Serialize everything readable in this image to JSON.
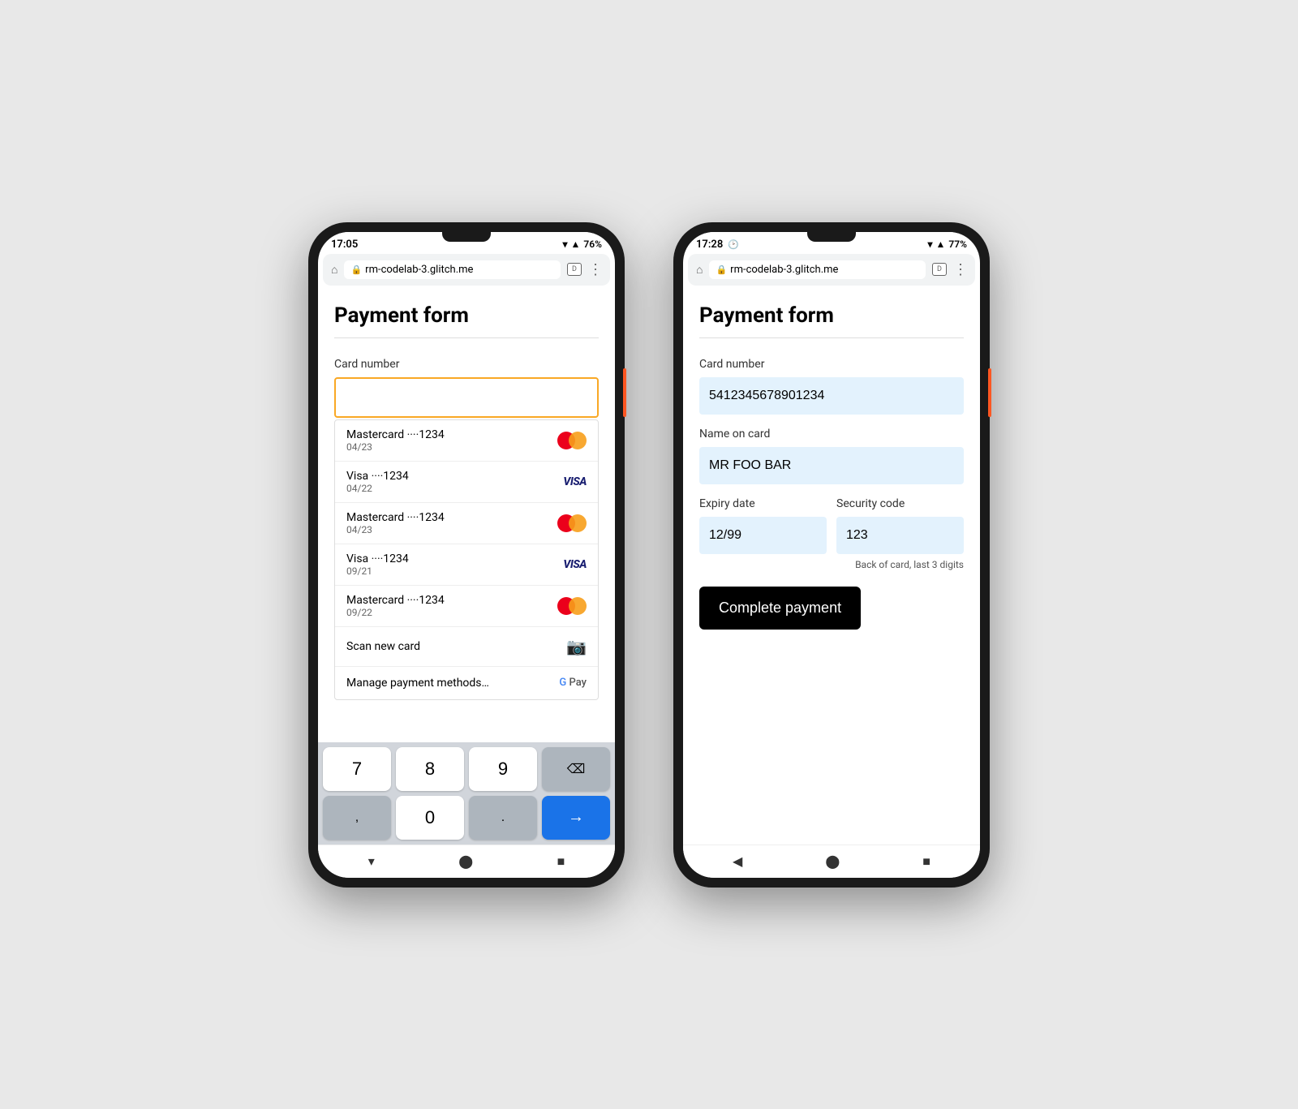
{
  "phone_left": {
    "status": {
      "time": "17:05",
      "battery": "76%",
      "url": "rm-codelab-3.glitch.me"
    },
    "page": {
      "title": "Payment form",
      "card_number_label": "Card number",
      "card_number_placeholder": ""
    },
    "suggestions": [
      {
        "name": "Mastercard ····1234",
        "expiry": "04/23",
        "type": "mastercard"
      },
      {
        "name": "Visa ····1234",
        "expiry": "04/22",
        "type": "visa"
      },
      {
        "name": "Mastercard ····1234",
        "expiry": "04/23",
        "type": "mastercard"
      },
      {
        "name": "Visa ····1234",
        "expiry": "09/21",
        "type": "visa"
      },
      {
        "name": "Mastercard ····1234",
        "expiry": "09/22",
        "type": "mastercard"
      }
    ],
    "scan_row": {
      "label": "Scan new card",
      "icon": "📷"
    },
    "manage_row": {
      "label": "Manage payment methods…"
    },
    "keyboard": {
      "keys": [
        "7",
        "8",
        "9",
        "⌫",
        ",",
        "0",
        ".",
        "→"
      ]
    },
    "nav": [
      "▾",
      "⬤",
      "■"
    ]
  },
  "phone_right": {
    "status": {
      "time": "17:28",
      "battery": "77%",
      "url": "rm-codelab-3.glitch.me"
    },
    "page": {
      "title": "Payment form",
      "card_number_label": "Card number",
      "card_number_value": "5412345678901234",
      "name_label": "Name on card",
      "name_value": "MR FOO BAR",
      "expiry_label": "Expiry date",
      "expiry_value": "12/99",
      "security_label": "Security code",
      "security_value": "123",
      "security_hint": "Back of card, last 3 digits",
      "submit_button": "Complete payment"
    },
    "nav": [
      "◀",
      "⬤",
      "■"
    ]
  }
}
